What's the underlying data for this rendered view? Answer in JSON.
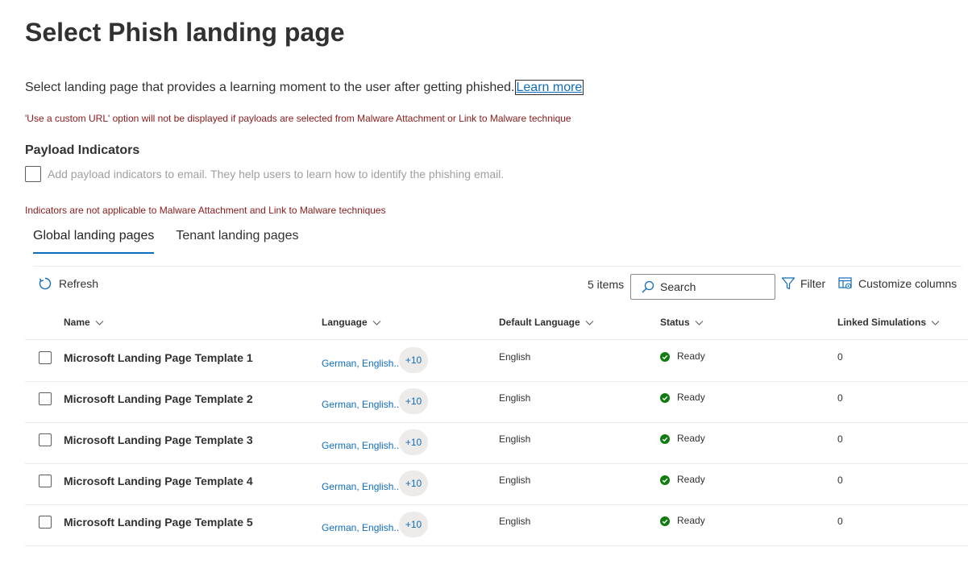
{
  "page": {
    "title": "Select Phish landing page",
    "intro_text": "Select landing page that provides a learning moment to the user after getting phished.",
    "learn_more": "Learn more",
    "custom_url_warning": "'Use a custom URL' option will not be displayed if payloads are selected from Malware Attachment or Link to Malware technique"
  },
  "payload_indicators": {
    "heading": "Payload Indicators",
    "checkbox_label": "Add payload indicators to email. They help users to learn how to identify the phishing email.",
    "checked": false,
    "warning": "Indicators are not applicable to Malware Attachment and Link to Malware techniques"
  },
  "tabs": [
    {
      "label": "Global landing pages",
      "active": true
    },
    {
      "label": "Tenant landing pages",
      "active": false
    }
  ],
  "toolbar": {
    "refresh_label": "Refresh",
    "item_count": "5 items",
    "search_placeholder": "Search",
    "filter_label": "Filter",
    "customize_label": "Customize columns"
  },
  "table": {
    "columns": [
      "Name",
      "Language",
      "Default Language",
      "Status",
      "Linked Simulations"
    ],
    "rows": [
      {
        "name": "Microsoft Landing Page Template 1",
        "language": "German, English..",
        "language_more": "+10",
        "default_language": "English",
        "status": "Ready",
        "linked": "0"
      },
      {
        "name": "Microsoft Landing Page Template 2",
        "language": "German, English..",
        "language_more": "+10",
        "default_language": "English",
        "status": "Ready",
        "linked": "0"
      },
      {
        "name": "Microsoft Landing Page Template 3",
        "language": "German, English..",
        "language_more": "+10",
        "default_language": "English",
        "status": "Ready",
        "linked": "0"
      },
      {
        "name": "Microsoft Landing Page Template 4",
        "language": "German, English..",
        "language_more": "+10",
        "default_language": "English",
        "status": "Ready",
        "linked": "0"
      },
      {
        "name": "Microsoft Landing Page Template 5",
        "language": "German, English..",
        "language_more": "+10",
        "default_language": "English",
        "status": "Ready",
        "linked": "0"
      }
    ]
  },
  "colors": {
    "accent": "#0f6cbd",
    "warning": "#8a1a1a",
    "success": "#107c10"
  },
  "icons": {
    "refresh": "refresh-icon",
    "search": "search-icon",
    "filter": "filter-icon",
    "customize": "customize-columns-icon",
    "status": "checkmark-circle-icon",
    "sort": "chevron-down-icon"
  }
}
